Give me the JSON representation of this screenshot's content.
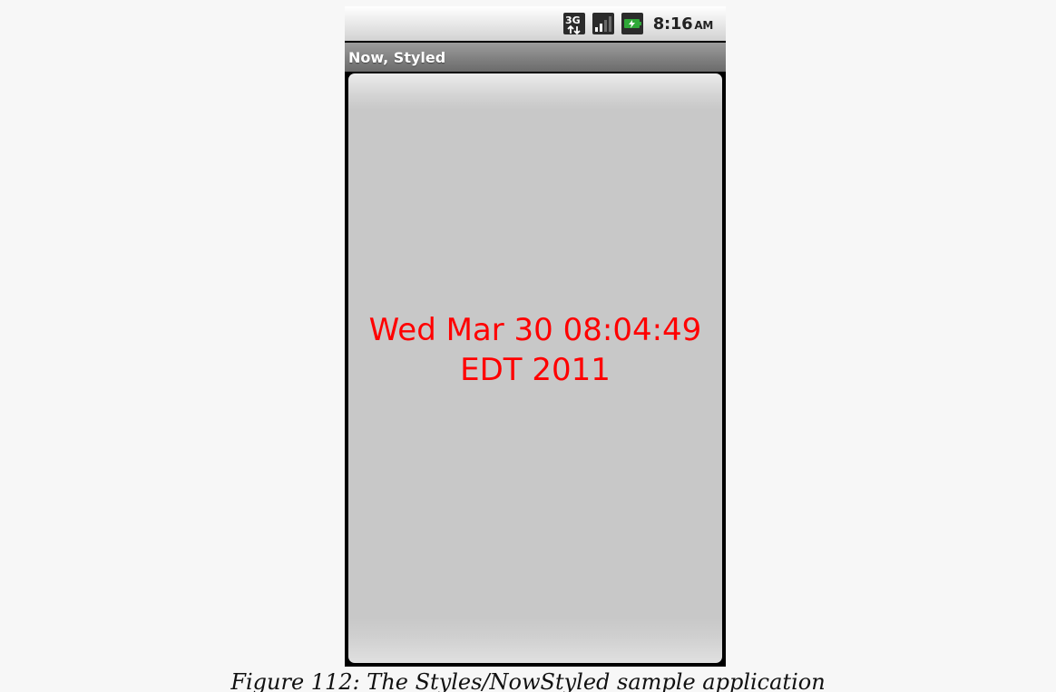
{
  "status_bar": {
    "network_icon": "3g-data-icon",
    "signal_icon": "signal-strength-icon",
    "battery_icon": "battery-charging-icon",
    "time": "8:16",
    "ampm": "AM"
  },
  "title_bar": {
    "title": "Now, Styled"
  },
  "content": {
    "time_text": "Wed Mar 30 08:04:49 EDT 2011",
    "text_color": "#ff0000"
  },
  "caption": {
    "text": "Figure 112: The Styles/NowStyled sample application"
  }
}
